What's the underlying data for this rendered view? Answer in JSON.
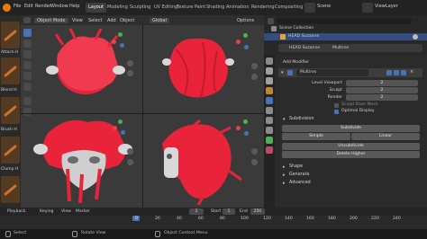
{
  "menu": [
    "File",
    "Edit",
    "Render",
    "Window",
    "Help"
  ],
  "workspace_tabs": [
    "Layout",
    "Modeling",
    "Sculpting",
    "UV Editing",
    "Texture Paint",
    "Shading",
    "Animation",
    "Rendering",
    "Compositing"
  ],
  "active_tab": "Layout",
  "scene": "Scene",
  "view_layer": "ViewLayer",
  "viewport": {
    "mode": "Object Mode",
    "menus": [
      "View",
      "Select",
      "Add",
      "Object"
    ],
    "transform": "Global",
    "options": "Options"
  },
  "toolshelf_labels": [
    "Attach H",
    "Blend H",
    "Brush H",
    "Clump H"
  ],
  "outliner": {
    "title": "Scene Collection",
    "items": [
      "HEAD Suzanne"
    ]
  },
  "properties": {
    "object_name": "HEAD Suzanne",
    "modifier_tab": "Multires",
    "add_modifier": "Add Modifier",
    "modifier_name": "Multires",
    "fields": [
      {
        "label": "Level Viewport",
        "value": "2"
      },
      {
        "label": "Sculpt",
        "value": "2"
      },
      {
        "label": "Render",
        "value": "2"
      }
    ],
    "sculpt_base_mesh": "Sculpt Base Mesh",
    "optimal_display": "Optimal Display",
    "subdivision_section": "Subdivision",
    "subdivide": "Subdivide",
    "simple": "Simple",
    "linear": "Linear",
    "unsubdivide": "Unsubdivide",
    "delete_higher": "Delete Higher",
    "sections": [
      "Shape",
      "Generate",
      "Advanced"
    ]
  },
  "timeline": {
    "playback": "Playback",
    "keying": "Keying",
    "view": "View",
    "marker": "Marker",
    "current_frame": "1",
    "start_label": "Start",
    "start": "1",
    "end_label": "End",
    "end": "250",
    "ticks": [
      "0",
      "20",
      "40",
      "60",
      "80",
      "100",
      "120",
      "140",
      "160",
      "180",
      "200",
      "220",
      "240"
    ]
  },
  "status": {
    "left": "Select",
    "mid": "Rotate View",
    "right": "Object Context Menu"
  },
  "colors": {
    "accent": "#4772b3",
    "hair": "#e8233a",
    "logo": "#e87d0d"
  }
}
